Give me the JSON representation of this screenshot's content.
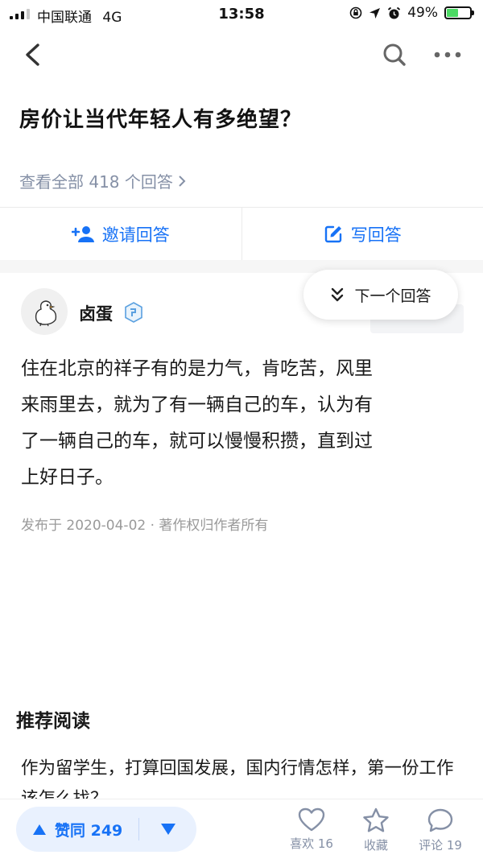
{
  "status_bar": {
    "carrier": "中国联通",
    "network": "4G",
    "time": "13:58",
    "battery": "49%",
    "battery_level": 0.49,
    "icons": [
      "signal-icon",
      "lock-rotation-icon",
      "location-arrow-icon",
      "alarm-icon",
      "battery-charging-icon"
    ]
  },
  "nav": {
    "icons": [
      "back-arrow-icon",
      "search-icon",
      "more-icon"
    ]
  },
  "question": {
    "title": "房价让当代年轻人有多绝望？",
    "view_all": "查看全部 418 个回答"
  },
  "actions": {
    "invite": "邀请回答",
    "write": "写回答"
  },
  "next_answer": "下一个回答",
  "author": {
    "name": "卤蛋"
  },
  "answer": {
    "lines": [
      "住在北京的祥子有的是力气，肯吃苦，风里",
      "来雨里去，就为了有一辆自己的车，认为有",
      "了一辆自己的车，就可以慢慢积攒，直到过",
      "上好日子。"
    ],
    "meta": "发布于 2020-04-02 · 著作权归作者所有"
  },
  "recommend": {
    "heading": "推荐阅读",
    "item": "作为留学生，打算回国发展，国内行情怎样，第一份工作该怎么找？"
  },
  "bottom": {
    "upvote": "赞同 249",
    "like": "喜欢 16",
    "favorite": "收藏",
    "comment": "评论 19"
  },
  "colors": {
    "accent": "#1772f6",
    "vote_bg": "#e9f1fe",
    "muted": "#8590a6"
  }
}
